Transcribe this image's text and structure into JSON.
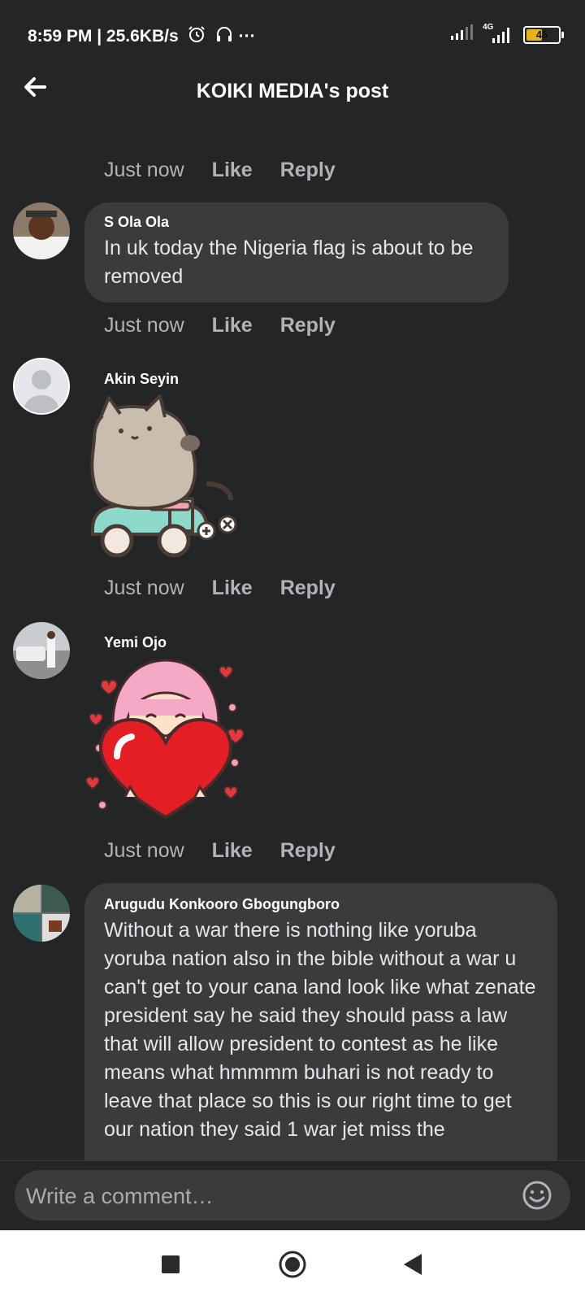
{
  "status_bar": {
    "time_speed": "8:59 PM | 25.6KB/s",
    "more": "···",
    "network": "4G",
    "battery": "45"
  },
  "header": {
    "title": "KOIKI MEDIA's post"
  },
  "comments": [
    {
      "time": "Just now",
      "like": "Like",
      "reply": "Reply"
    },
    {
      "name": "S Ola Ola",
      "text": "In uk today the Nigeria flag is about to be removed",
      "time": "Just now",
      "like": "Like",
      "reply": "Reply"
    },
    {
      "name": "Akin Seyin",
      "time": "Just now",
      "like": "Like",
      "reply": "Reply"
    },
    {
      "name": "Yemi Ojo",
      "time": "Just now",
      "like": "Like",
      "reply": "Reply"
    },
    {
      "name": "Arugudu Konkooro Gbogungboro",
      "text": "Without a war there is nothing like yoruba yoruba nation also in the bible without a war u can't get to your cana land look like what zenate president say he said they should pass a law that will allow president to contest as he like means what hmmmm buhari is not ready to leave that place so this is our right time to get our nation they said 1 war jet miss the"
    }
  ],
  "composer": {
    "placeholder": "Write a comment…"
  },
  "colors": {
    "background": "#242526",
    "bubble": "#3a3b3c",
    "muted_text": "#b0b3b8",
    "battery": "#e7b11b"
  }
}
